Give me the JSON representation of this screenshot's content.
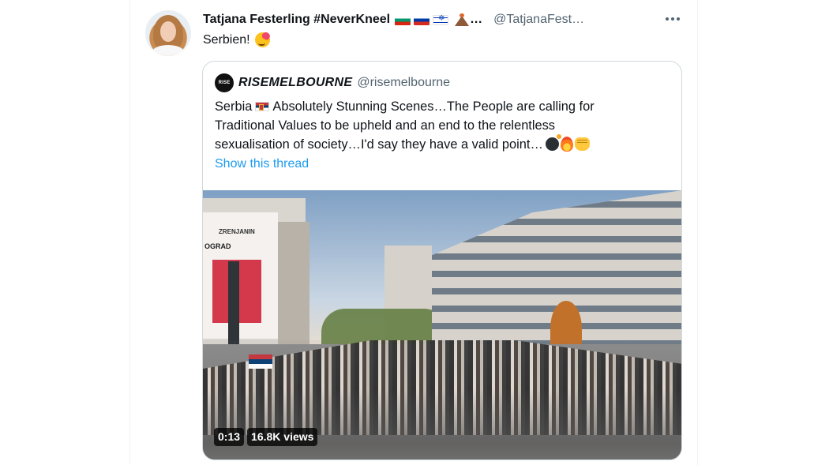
{
  "tweet": {
    "display_name": "Tatjana Festerling #NeverKneel",
    "name_truncation": "…",
    "handle": "@TatjanaFest…",
    "text": "Serbien!",
    "emoji": "smiling-face-with-hearts-icon",
    "more_icon": "more-horizontal-icon"
  },
  "quoted": {
    "avatar_text": "RISE",
    "display_name": "RISEMELBOURNE",
    "handle": "@risemelbourne",
    "text_lines": [
      "Absolutely Stunning Scenes…The People are calling for",
      "Traditional Values to be upheld and an end to the relentless",
      "sexualisation of society…I'd say they have a valid point…"
    ],
    "text_prefix": "Serbia",
    "show_thread": "Show this thread",
    "video": {
      "duration": "0:13",
      "views": "16.8K views",
      "billboard_top": "ZRENJANIN",
      "billboard_bottom": "OGRAD"
    }
  },
  "colors": {
    "link": "#1d9bf0",
    "secondary_text": "#536471",
    "border": "#cfd9de"
  }
}
